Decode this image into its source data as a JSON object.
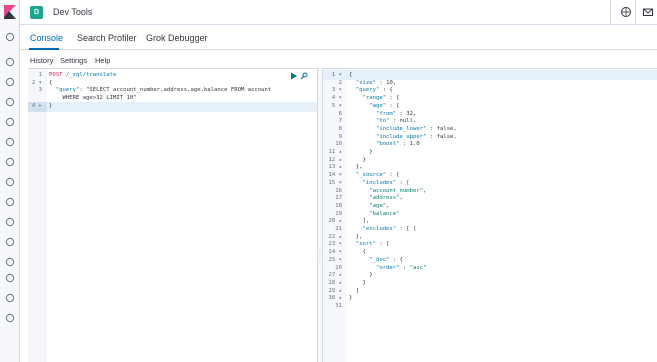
{
  "header": {
    "app_badge": "D",
    "title": "Dev Tools"
  },
  "tabs": [
    {
      "label": "Console",
      "active": true
    },
    {
      "label": "Search Profiler",
      "active": false
    },
    {
      "label": "Grok Debugger",
      "active": false
    }
  ],
  "menu": {
    "history": "History",
    "settings": "Settings",
    "help": "Help"
  },
  "request": {
    "lines": [
      {
        "num": "1",
        "text": "POST /_sql/translate"
      },
      {
        "num": "2 ▾",
        "text": "{"
      },
      {
        "num": "3",
        "text": "  \"query\": \"SELECT account_number,address,age,balance FROM account"
      },
      {
        "num": "",
        "text": "    WHERE age>32 LIMIT 10\""
      },
      {
        "num": "4 ▸",
        "text": "}"
      }
    ]
  },
  "response": {
    "lines": [
      {
        "num": "1 ▾",
        "text": "{"
      },
      {
        "num": "2",
        "text": "  \"size\" : 10,"
      },
      {
        "num": "3 ▾",
        "text": "  \"query\" : {"
      },
      {
        "num": "4 ▾",
        "text": "    \"range\" : {"
      },
      {
        "num": "5 ▾",
        "text": "      \"age\" : {"
      },
      {
        "num": "6",
        "text": "        \"from\" : 32,"
      },
      {
        "num": "7",
        "text": "        \"to\" : null,"
      },
      {
        "num": "8",
        "text": "        \"include_lower\" : false,"
      },
      {
        "num": "9",
        "text": "        \"include_upper\" : false,"
      },
      {
        "num": "10",
        "text": "        \"boost\" : 1.0"
      },
      {
        "num": "11 ▴",
        "text": "      }"
      },
      {
        "num": "12 ▴",
        "text": "    }"
      },
      {
        "num": "13 ▴",
        "text": "  },"
      },
      {
        "num": "14 ▾",
        "text": "  \"_source\" : {"
      },
      {
        "num": "15 ▾",
        "text": "    \"includes\" : ["
      },
      {
        "num": "16",
        "text": "      \"account_number\","
      },
      {
        "num": "17",
        "text": "      \"address\","
      },
      {
        "num": "18",
        "text": "      \"age\","
      },
      {
        "num": "19",
        "text": "      \"balance\""
      },
      {
        "num": "20 ▴",
        "text": "    ],"
      },
      {
        "num": "21",
        "text": "    \"excludes\" : [ ]"
      },
      {
        "num": "22 ▴",
        "text": "  },"
      },
      {
        "num": "23 ▾",
        "text": "  \"sort\" : ["
      },
      {
        "num": "24 ▾",
        "text": "    {"
      },
      {
        "num": "25 ▾",
        "text": "      \"_doc\" : {"
      },
      {
        "num": "26",
        "text": "        \"order\" : \"asc\""
      },
      {
        "num": "27 ▴",
        "text": "      }"
      },
      {
        "num": "28 ▴",
        "text": "    }"
      },
      {
        "num": "29 ▴",
        "text": "  ]"
      },
      {
        "num": "30 ▴",
        "text": "}"
      },
      {
        "num": "31",
        "text": ""
      }
    ]
  },
  "colors": {
    "accent": "#006bb4",
    "method": "#c7254e",
    "key": "#0079a5",
    "string": "#017d73",
    "badge": "#20a58f"
  },
  "icons": {
    "sidebar": [
      "clock-icon",
      "discover-icon",
      "visualize-icon",
      "dashboard-icon",
      "canvas-icon",
      "maps-icon",
      "ml-icon",
      "infra-icon",
      "logs-icon",
      "apm-icon",
      "uptime-icon",
      "siem-icon",
      "devtools-icon",
      "monitoring-icon",
      "management-icon"
    ],
    "header": [
      "help-icon",
      "mail-icon"
    ]
  }
}
